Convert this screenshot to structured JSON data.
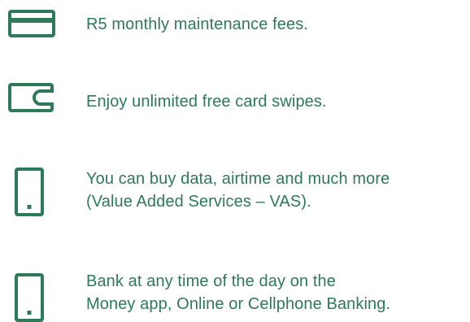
{
  "theme": {
    "accent": "#2c7a57"
  },
  "features": [
    {
      "icon": "credit-card-icon",
      "lines": [
        "R5 monthly maintenance fees."
      ]
    },
    {
      "icon": "wallet-icon",
      "lines": [
        "Enjoy unlimited free card swipes."
      ]
    },
    {
      "icon": "mobile-phone-icon",
      "lines": [
        "You can buy data, airtime and much more",
        "(Value Added Services – VAS)."
      ]
    },
    {
      "icon": "mobile-phone-icon",
      "lines": [
        "Bank at any time of the day on the",
        "Money app, Online or Cellphone Banking."
      ]
    }
  ]
}
